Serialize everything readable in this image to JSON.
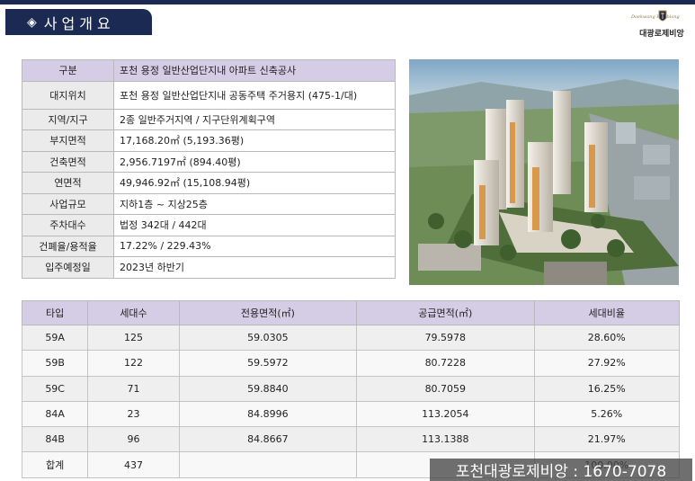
{
  "header": {
    "diamond": "◈",
    "title": "사업개요"
  },
  "brand": {
    "script": "Daekwang Rojebiang",
    "name": "대광로제비앙"
  },
  "overview": {
    "head": {
      "label": "구분",
      "value": "포천 용정 일반산업단지내 아파트 신축공사"
    },
    "rows": [
      {
        "label": "대지위치",
        "value": "포천 용정 일반산업단지내 공동주택 주거용지 (475-1/대)"
      },
      {
        "label": "지역/지구",
        "value": "2종 일반주거지역 / 지구단위계획구역"
      },
      {
        "label": "부지면적",
        "value": "17,168.20㎡ (5,193.36평)"
      },
      {
        "label": "건축면적",
        "value": "2,956.7197㎡ (894.40평)"
      },
      {
        "label": "연면적",
        "value": "49,946.92㎡ (15,108.94평)"
      },
      {
        "label": "사업규모",
        "value": "지하1층 ~ 지상25층"
      },
      {
        "label": "주차대수",
        "value": "법정  342대 / 442대"
      },
      {
        "label": "건폐율/용적율",
        "value": "17.22% / 229.43%"
      },
      {
        "label": "입주예정일",
        "value": "2023년 하반기"
      }
    ]
  },
  "type_table": {
    "headers": [
      "타입",
      "세대수",
      "전용면적(㎡)",
      "공급면적(㎡)",
      "세대비율"
    ],
    "rows": [
      [
        "59A",
        "125",
        "59.0305",
        "79.5978",
        "28.60%"
      ],
      [
        "59B",
        "122",
        "59.5972",
        "80.7228",
        "27.92%"
      ],
      [
        "59C",
        "71",
        "59.8840",
        "80.7059",
        "16.25%"
      ],
      [
        "84A",
        "23",
        "84.8996",
        "113.2054",
        "5.26%"
      ],
      [
        "84B",
        "96",
        "84.8667",
        "113.1388",
        "21.97%"
      ],
      [
        "합계",
        "437",
        "",
        "",
        "100.00%"
      ]
    ]
  },
  "contact": {
    "text": "포천대광로제비앙 : 1670-7078"
  },
  "colors": {
    "navy": "#1b2a52",
    "header_purple": "#d5cde6",
    "label_gray": "#ebebeb"
  }
}
